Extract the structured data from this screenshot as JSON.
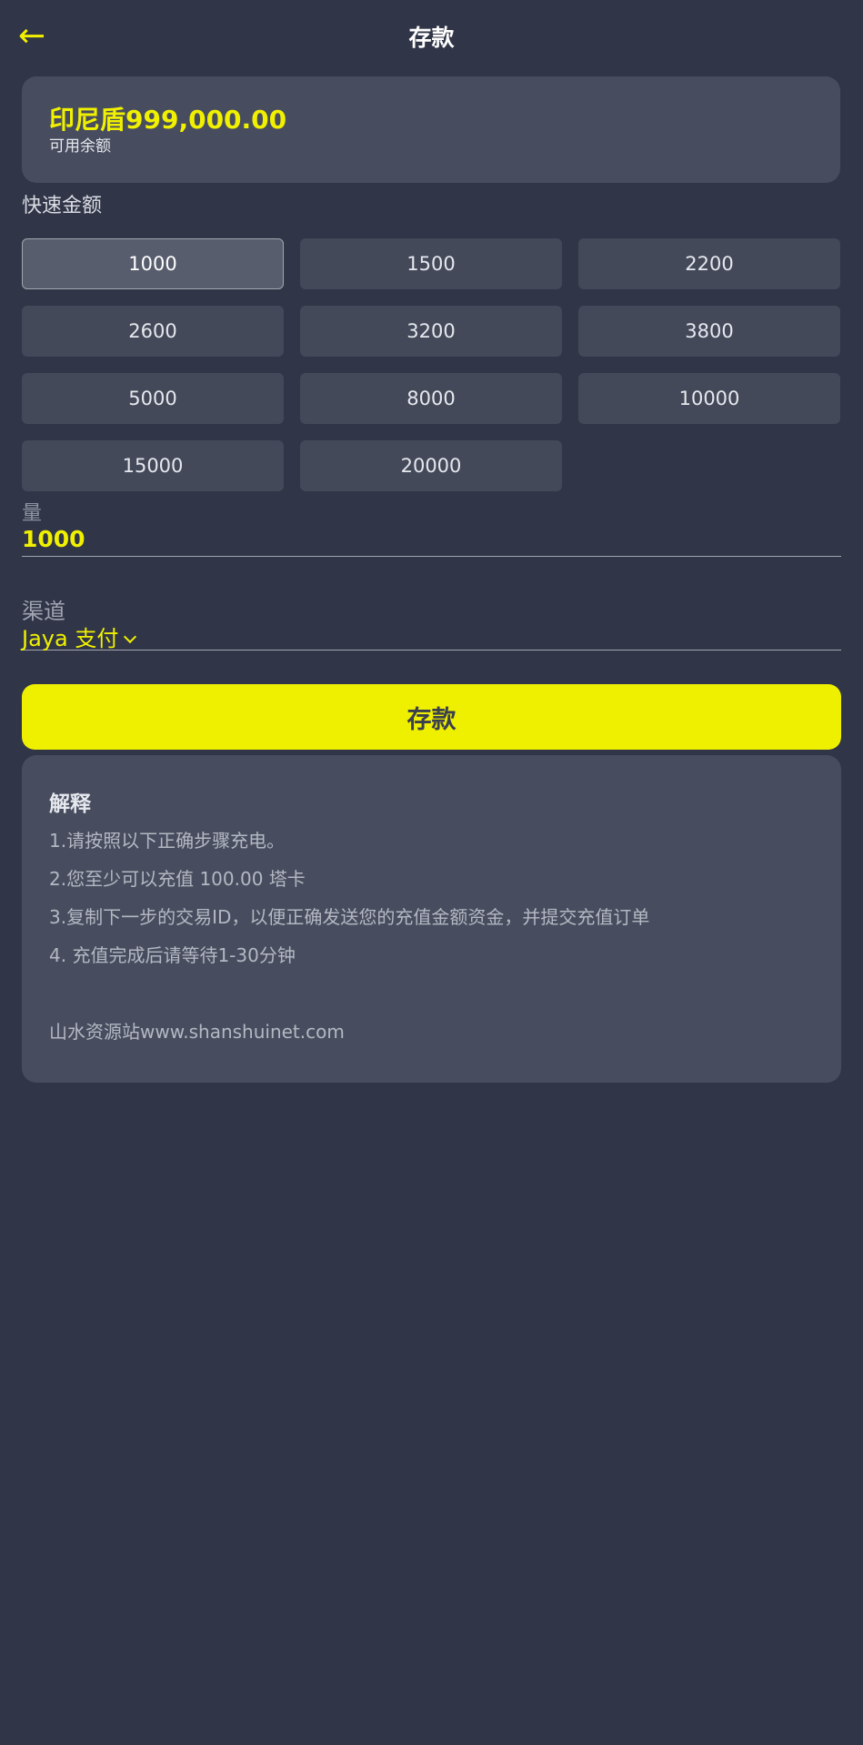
{
  "header": {
    "back_icon": "←",
    "title": "存款"
  },
  "balance": {
    "amount": "印尼盾999,000.00",
    "label": "可用余额"
  },
  "quick_amounts": {
    "label": "快速金额",
    "options": [
      "1000",
      "1500",
      "2200",
      "2600",
      "3200",
      "3800",
      "5000",
      "8000",
      "10000",
      "15000",
      "20000"
    ],
    "selected": "1000"
  },
  "amount_field": {
    "label": "量",
    "value": "1000"
  },
  "channel": {
    "label": "渠道",
    "value": "Jaya 支付"
  },
  "deposit_button": {
    "label": "存款"
  },
  "explanation": {
    "title": "解释",
    "lines": [
      "1.请按照以下正确步骤充电。",
      "2.您至少可以充值  100.00 塔卡",
      "3.复制下一步的交易ID，以便正确发送您的充值金额资金，并提交充值订单",
      "4. 充值完成后请等待1-30分钟",
      "山水资源站www.shanshuinet.com"
    ]
  },
  "colors": {
    "background": "#303547",
    "card": "#474d5e",
    "accent": "#f0f000"
  }
}
